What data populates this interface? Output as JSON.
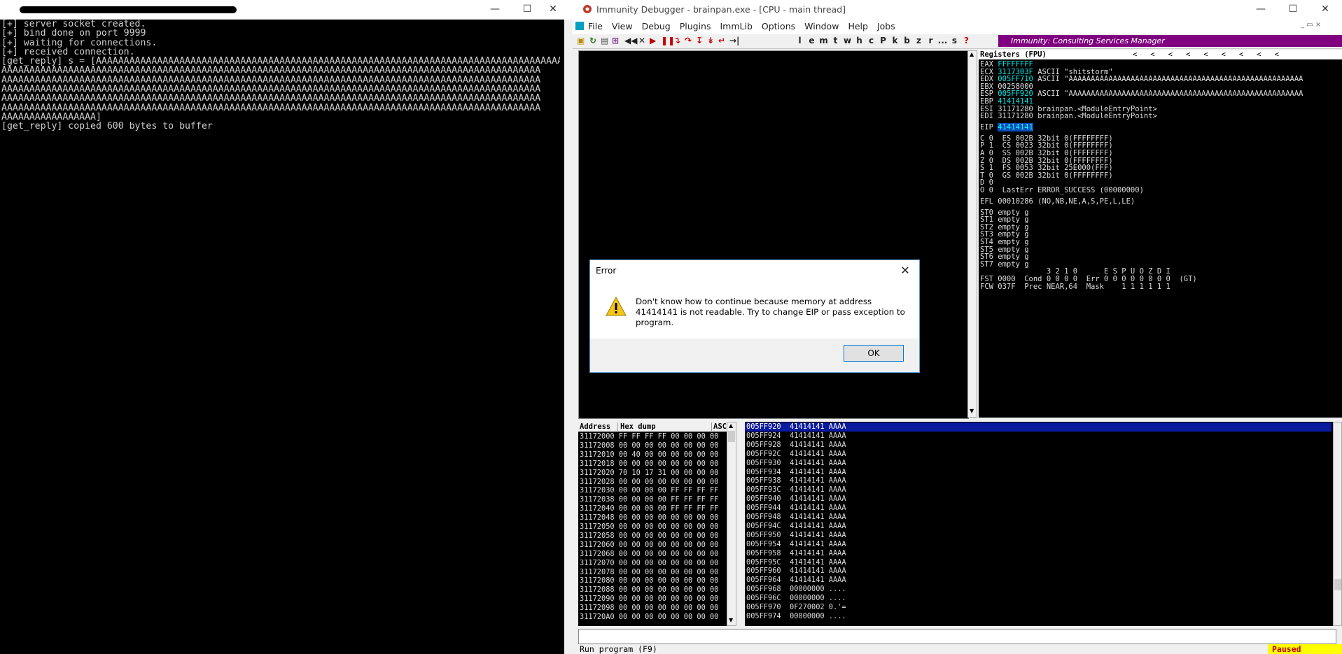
{
  "terminal": {
    "title_redacted": true,
    "controls": {
      "minimize": "—",
      "maximize": "☐",
      "close": "✕"
    },
    "lines": [
      "[+] server socket created.",
      "[+] bind done on port 9999",
      "[+] waiting for connections.",
      "[+] received connection.",
      "[get_reply] s = [AAAAAAAAAAAAAAAAAAAAAAAAAAAAAAAAAAAAAAAAAAAAAAAAAAAAAAAAAAAAAAAAAAAAAAAAAAAAAAAAAAAA",
      "AAAAAAAAAAAAAAAAAAAAAAAAAAAAAAAAAAAAAAAAAAAAAAAAAAAAAAAAAAAAAAAAAAAAAAAAAAAAAAAAAAAAAAAAAAAAAAAAA",
      "AAAAAAAAAAAAAAAAAAAAAAAAAAAAAAAAAAAAAAAAAAAAAAAAAAAAAAAAAAAAAAAAAAAAAAAAAAAAAAAAAAAAAAAAAAAAAAAAA",
      "AAAAAAAAAAAAAAAAAAAAAAAAAAAAAAAAAAAAAAAAAAAAAAAAAAAAAAAAAAAAAAAAAAAAAAAAAAAAAAAAAAAAAAAAAAAAAAAAA",
      "AAAAAAAAAAAAAAAAAAAAAAAAAAAAAAAAAAAAAAAAAAAAAAAAAAAAAAAAAAAAAAAAAAAAAAAAAAAAAAAAAAAAAAAAAAAAAAAAA",
      "AAAAAAAAAAAAAAAAAAAAAAAAAAAAAAAAAAAAAAAAAAAAAAAAAAAAAAAAAAAAAAAAAAAAAAAAAAAAAAAAAAAAAAAAAAAAAAAAA",
      "AAAAAAAAAAAAAAAAA]",
      "[get_reply] copied 600 bytes to buffer"
    ]
  },
  "immunity": {
    "title": "Immunity Debugger - brainpan.exe - [CPU - main thread]",
    "controls": {
      "minimize": "—",
      "maximize": "☐",
      "close": "✕"
    },
    "menu": [
      "File",
      "View",
      "Debug",
      "Plugins",
      "ImmLib",
      "Options",
      "Window",
      "Help",
      "Jobs"
    ],
    "toolbar_letters": [
      "l",
      "e",
      "m",
      "t",
      "w",
      "h",
      "c",
      "P",
      "k",
      "b",
      "z",
      "r",
      "...",
      "s",
      "?"
    ],
    "banner": "Immunity: Consulting Services Manager",
    "registers": {
      "header": "Registers (FPU)",
      "lines": [
        {
          "name": "EAX",
          "value": "FFFFFFFF",
          "comment": "",
          "hl": true
        },
        {
          "name": "ECX",
          "value": "3117303F",
          "comment": "ASCII \"shitstorm\"",
          "hl": true
        },
        {
          "name": "EDX",
          "value": "005FF710",
          "comment": "ASCII \"AAAAAAAAAAAAAAAAAAAAAAAAAAAAAAAAAAAAAAAAAAAAAAAAAAAAA",
          "hl": true
        },
        {
          "name": "EBX",
          "value": "00258000",
          "comment": "",
          "hl": false
        },
        {
          "name": "ESP",
          "value": "005FF920",
          "comment": "ASCII \"AAAAAAAAAAAAAAAAAAAAAAAAAAAAAAAAAAAAAAAAAAAAAAAAAAAAA",
          "hl": true
        },
        {
          "name": "EBP",
          "value": "41414141",
          "comment": "",
          "hl": true
        },
        {
          "name": "ESI",
          "value": "31171280",
          "comment": "brainpan.<ModuleEntryPoint>",
          "hl": false
        },
        {
          "name": "EDI",
          "value": "31171280",
          "comment": "brainpan.<ModuleEntryPoint>",
          "hl": false
        }
      ],
      "eip": {
        "name": "EIP",
        "value": "41414141"
      },
      "flags": [
        "C 0  ES 002B 32bit 0(FFFFFFFF)",
        "P 1  CS 0023 32bit 0(FFFFFFFF)",
        "A 0  SS 002B 32bit 0(FFFFFFFF)",
        "Z 0  DS 002B 32bit 0(FFFFFFFF)",
        "S 1  FS 0053 32bit 25E000(FFF)",
        "T 0  GS 002B 32bit 0(FFFFFFFF)",
        "D 0",
        "O 0  LastErr ERROR_SUCCESS (00000000)"
      ],
      "efl": "EFL 00010286 (NO,NB,NE,A,S,PE,L,LE)",
      "fpu": [
        "ST0 empty g",
        "ST1 empty g",
        "ST2 empty g",
        "ST3 empty g",
        "ST4 empty g",
        "ST5 empty g",
        "ST6 empty g",
        "ST7 empty g"
      ],
      "fpu_hdr": "               3 2 1 0      E S P U O Z D I",
      "fst": "FST 0000  Cond 0 0 0 0  Err 0 0 0 0 0 0 0 0  (GT)",
      "fcw": "FCW 037F  Prec NEAR,64  Mask    1 1 1 1 1 1"
    },
    "dump": {
      "headers": [
        "Address",
        "Hex dump",
        "ASC"
      ],
      "rows": [
        "31172000 FF FF FF FF 00 00 00 00",
        "31172008 00 00 00 00 00 00 00 00",
        "31172010 00 40 00 00 00 00 00 00",
        "31172018 00 00 00 00 00 00 00 00",
        "31172020 70 10 17 31 00 00 00 00",
        "31172028 00 00 00 00 00 00 00 00",
        "31172030 00 00 00 00 FF FF FF FF",
        "31172038 00 00 00 00 FF FF FF FF",
        "31172040 00 00 00 00 FF FF FF FF",
        "31172048 00 00 00 00 00 00 00 00",
        "31172050 00 00 00 00 00 00 00 00",
        "31172058 00 00 00 00 00 00 00 00",
        "31172060 00 00 00 00 00 00 00 00",
        "31172068 00 00 00 00 00 00 00 00",
        "31172070 00 00 00 00 00 00 00 00",
        "31172078 00 00 00 00 00 00 00 00",
        "31172080 00 00 00 00 00 00 00 00",
        "31172088 00 00 00 00 00 00 00 00",
        "31172090 00 00 00 00 00 00 00 00",
        "31172098 00 00 00 00 00 00 00 00",
        "311720A0 00 00 00 00 00 00 00 00"
      ]
    },
    "stack": [
      "005FF920  41414141 AAAA",
      "005FF924  41414141 AAAA",
      "005FF928  41414141 AAAA",
      "005FF92C  41414141 AAAA",
      "005FF930  41414141 AAAA",
      "005FF934  41414141 AAAA",
      "005FF938  41414141 AAAA",
      "005FF93C  41414141 AAAA",
      "005FF940  41414141 AAAA",
      "005FF944  41414141 AAAA",
      "005FF948  41414141 AAAA",
      "005FF94C  41414141 AAAA",
      "005FF950  41414141 AAAA",
      "005FF954  41414141 AAAA",
      "005FF958  41414141 AAAA",
      "005FF95C  41414141 AAAA",
      "005FF960  41414141 AAAA",
      "005FF964  41414141 AAAA",
      "005FF968  00000000 ....",
      "005FF96C  00000000 ....",
      "005FF970  0F270002 0.'=",
      "005FF974  00000000 ...."
    ],
    "status": {
      "text": "Run program (F9)",
      "state": "Paused"
    }
  },
  "dialog": {
    "title": "Error",
    "close": "✕",
    "message": "Don't know how to continue because memory at address 41414141 is not readable. Try to change EIP or pass exception to program.",
    "ok": "OK"
  }
}
